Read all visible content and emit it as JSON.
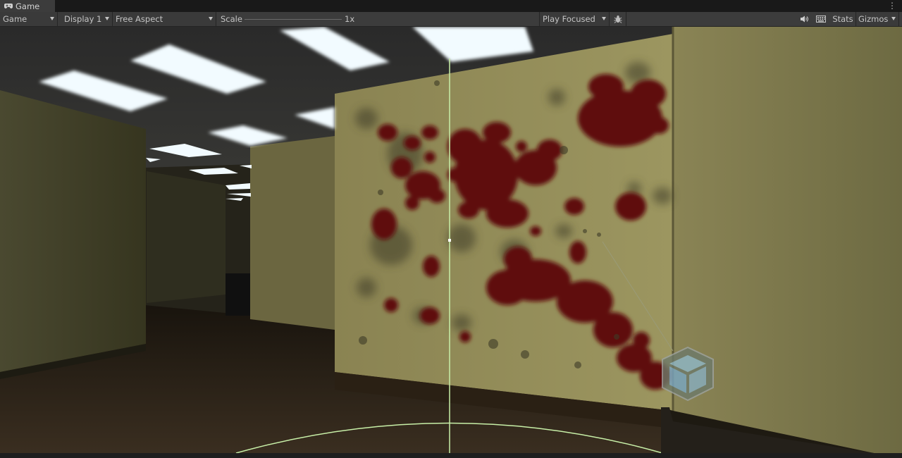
{
  "tab": {
    "title": "Game",
    "icon": "gamepad-icon"
  },
  "menu": {
    "icon": "kebab-menu-icon",
    "glyph": "⋮"
  },
  "toolbar": {
    "view_mode": "Game",
    "display": "Display 1",
    "aspect": "Free Aspect",
    "scale_label": "Scale",
    "scale_value": "1x",
    "play_mode": "Play Focused",
    "bug_icon": "bug-icon",
    "audio_icon": "speaker-icon",
    "grid_icon": "keyboard-icon",
    "stats_label": "Stats",
    "gizmos_label": "Gizmos"
  },
  "colors": {
    "toolbar_bg": "#3c3c3c",
    "wall": "#8f8a55",
    "ceiling": "#2b2b2b",
    "floor": "#2d2418",
    "blood": "#5a0d0d",
    "gizmo_line": "#c8f0a8"
  }
}
